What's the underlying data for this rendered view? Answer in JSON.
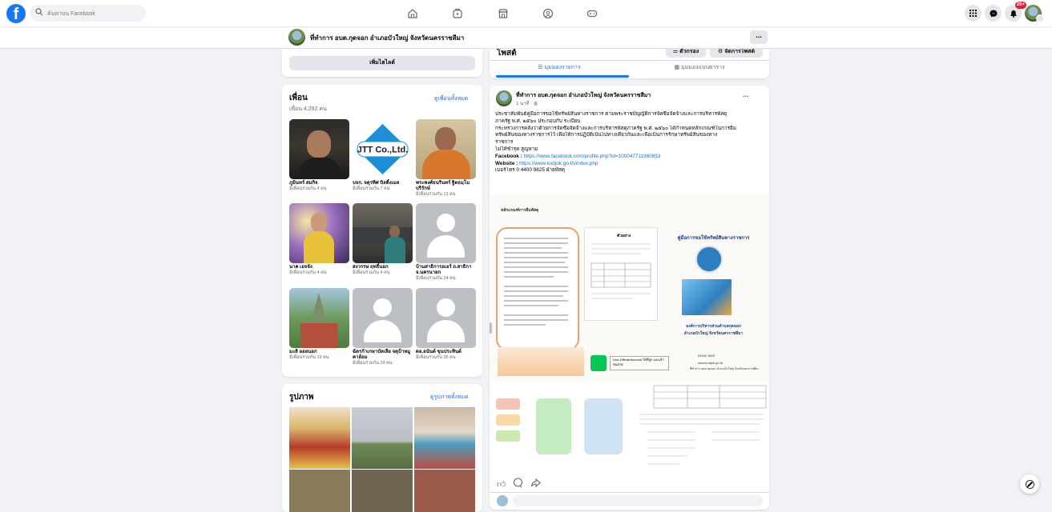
{
  "topbar": {
    "search_placeholder": "ค้นหาบน Facebook",
    "notification_count": "20+"
  },
  "page": {
    "name": "ที่ทำการ อบต.กุดจอก อำเภอบัวใหญ่ จังหวัดนครราชสีมา",
    "more": "..."
  },
  "intro": {
    "add_featured": "เพิ่มไฮไลต์"
  },
  "friends": {
    "title": "เพื่อน",
    "count": "เพื่อน 4,292 คน",
    "see_all": "ดูเพื่อนทั้งหมด",
    "items": [
      {
        "name": "ภูมินทร์ สมกิจ",
        "mutual": "มีเพื่อนร่วมกัน 4 คน"
      },
      {
        "name": "บจก. จตุรทิศ บิลดิ้งเมล",
        "mutual": "มีเพื่อนร่วมกัน 7 คน"
      },
      {
        "name": "พระพงศ์ธนรินทร์ ฐิตธมฺโม บริรักษ์",
        "mutual": "มีเพื่อนร่วมกัน 13 คน"
      },
      {
        "name": "นาค เอจจัง",
        "mutual": "มีเพื่อนร่วมกัน 4 คน"
      },
      {
        "name": "สงวรรษ ฤทธิ์นอก",
        "mutual": "มีเพื่อนร่วมกัน 4 คน"
      },
      {
        "name": "บ้านสาธิการอเอร์ ถ.สาธิกา จ.นครนายก",
        "mutual": "มีเพื่อนร่วมกัน 24 คน"
      },
      {
        "name": "มะลิ ออยนอก",
        "mutual": "มีเพื่อนร่วมกัน 19 คน"
      },
      {
        "name": "ฉัตรก้าเกษาบัลเลีย จตุป้าหมูคาฮ์อม",
        "mutual": "มีเพื่อนร่วมกัน 29 คน"
      },
      {
        "name": "ดอ.อนันต์ ขุนประทินต์",
        "mutual": "มีเพื่อนร่วมกัน 35 คน"
      }
    ]
  },
  "photos": {
    "title": "รูปภาพ",
    "see_all": "ดูรูปภาพทั้งหมด"
  },
  "posts_header": {
    "title": "โพสต์",
    "filter": "ตัวกรอง",
    "manage": "จัดการโพสต์",
    "list_view": "มุมมองรายการ",
    "grid_view": "มุมมองแบบตาราง"
  },
  "post": {
    "author": "ที่ทำการ อบต.กุดจอก อำเภอบัวใหญ่ จังหวัดนครราชสีมา",
    "time": "1 นาที · ",
    "more": "...",
    "lines": [
      "ประชาสัมพันธ์คู่มือการขอใช้ทรัพย์สินทางราชการ ตามพระราชบัญญัติการจัดซื้อจัดจ้างและการบริหารพัสดุ",
      "ภาครัฐ พ.ศ. ๒๕๖๐ ประกอบกับ ระเบียบ",
      "กระทรวงการคลังว่าด้วยการจัดซื้อจัดจ้างและการบริหารพัสดุภาครัฐ พ.ศ. ๒๕๖๐ ได้กำหนดหลักเกณฑ์ในการยืม",
      "ทรัพย์สินของทางราชการไว้ เพื่อให้การปฏิบัติเป็นไปทางเดียวกันและเพื่อเป็นการรักษาทรัพย์สินของทาง",
      "ราชการ",
      "ไม่ให้ชำรุด สูญหาย"
    ],
    "facebook_label": "Facebook : ",
    "facebook_url": "https://www.facebook.com/profile.php?id=100047711960853",
    "website_label": "Website : ",
    "website_url": "https://www.kudjok.go.th/index.php",
    "phone": "เบอร์โทร 0 4400 9825 ฝ่ายพัสดุ",
    "image_heading": "คู่มือการขอใช้ทรัพย์สินทางราชการ",
    "image_org_line1": "องค์การบริหารส่วนตำบลกุดจอก",
    "image_org_line2": "อำเภอบัวใหญ่ จังหวัดนครราชสีมา",
    "image_sample_label": "ตัวอย่าง",
    "image_form_label": "หลักเกณฑ์การยืมพัสดุ",
    "image_line_label": "Line Official Account ได้ที่ลูก และเจ้าชนสาย",
    "image_phone": "04400 9825",
    "image_web": "www.kudjok.go.th",
    "image_fb": "ที่ทำการ อบต.กุดจอก อำเภอบัวใหญ่ จังหวัดนครราชสีมา"
  },
  "colors": {
    "brand": "#1877f2",
    "link": "#216fdb",
    "badge": "#e41e3f"
  }
}
